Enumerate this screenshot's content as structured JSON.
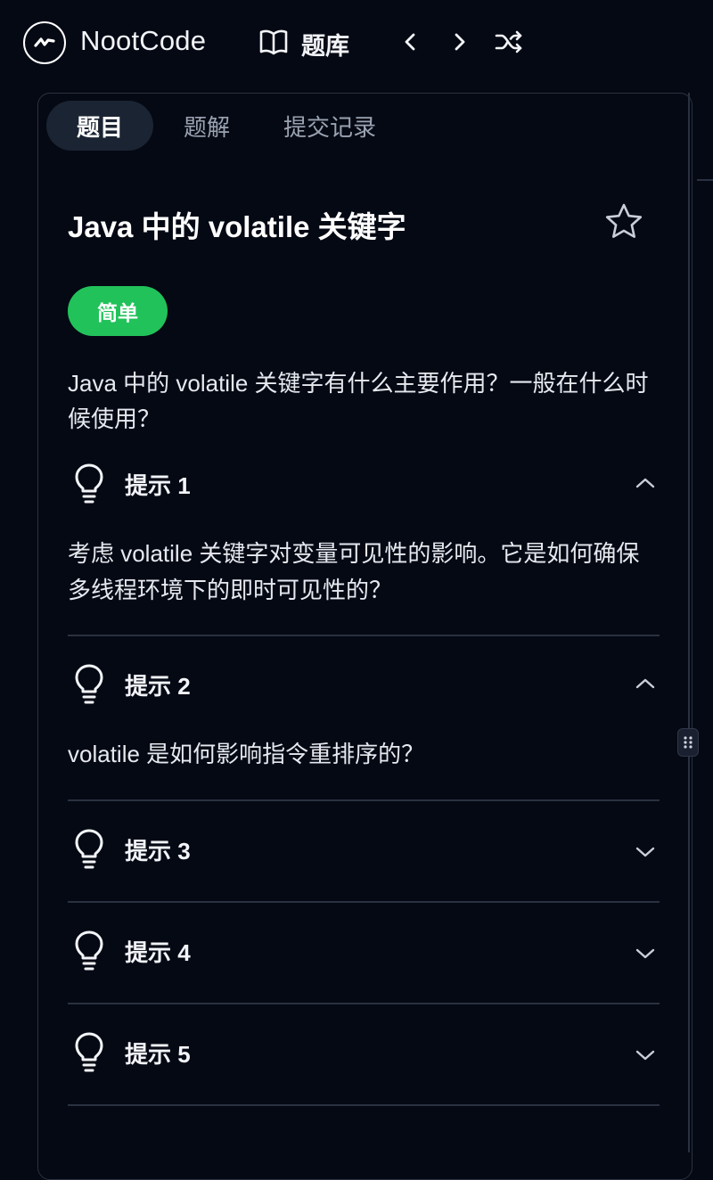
{
  "header": {
    "brand": "NootCode",
    "library_label": "题库"
  },
  "tabs": [
    {
      "label": "题目",
      "active": true
    },
    {
      "label": "题解",
      "active": false
    },
    {
      "label": "提交记录",
      "active": false
    }
  ],
  "problem": {
    "title": "Java 中的 volatile 关键字",
    "difficulty": "简单",
    "difficulty_color": "#22c25a",
    "question": "Java 中的 volatile 关键字有什么主要作用？一般在什么时候使用？"
  },
  "hints": [
    {
      "label": "提示 1",
      "expanded": true,
      "body": "考虑 volatile 关键字对变量可见性的影响。它是如何确保多线程环境下的即时可见性的？"
    },
    {
      "label": "提示 2",
      "expanded": true,
      "body": "volatile 是如何影响指令重排序的？"
    },
    {
      "label": "提示 3",
      "expanded": false
    },
    {
      "label": "提示 4",
      "expanded": false
    },
    {
      "label": "提示 5",
      "expanded": false
    }
  ],
  "icons": {
    "logo": "nootcode-logo-icon",
    "library": "book-open-icon",
    "prev": "chevron-left-icon",
    "next": "chevron-right-icon",
    "shuffle": "shuffle-icon",
    "star": "star-icon",
    "hint": "lightbulb-icon",
    "drag": "drag-handle-icon"
  },
  "colors": {
    "background": "#050914",
    "accent_green": "#22c25a",
    "border": "#2a3140"
  }
}
